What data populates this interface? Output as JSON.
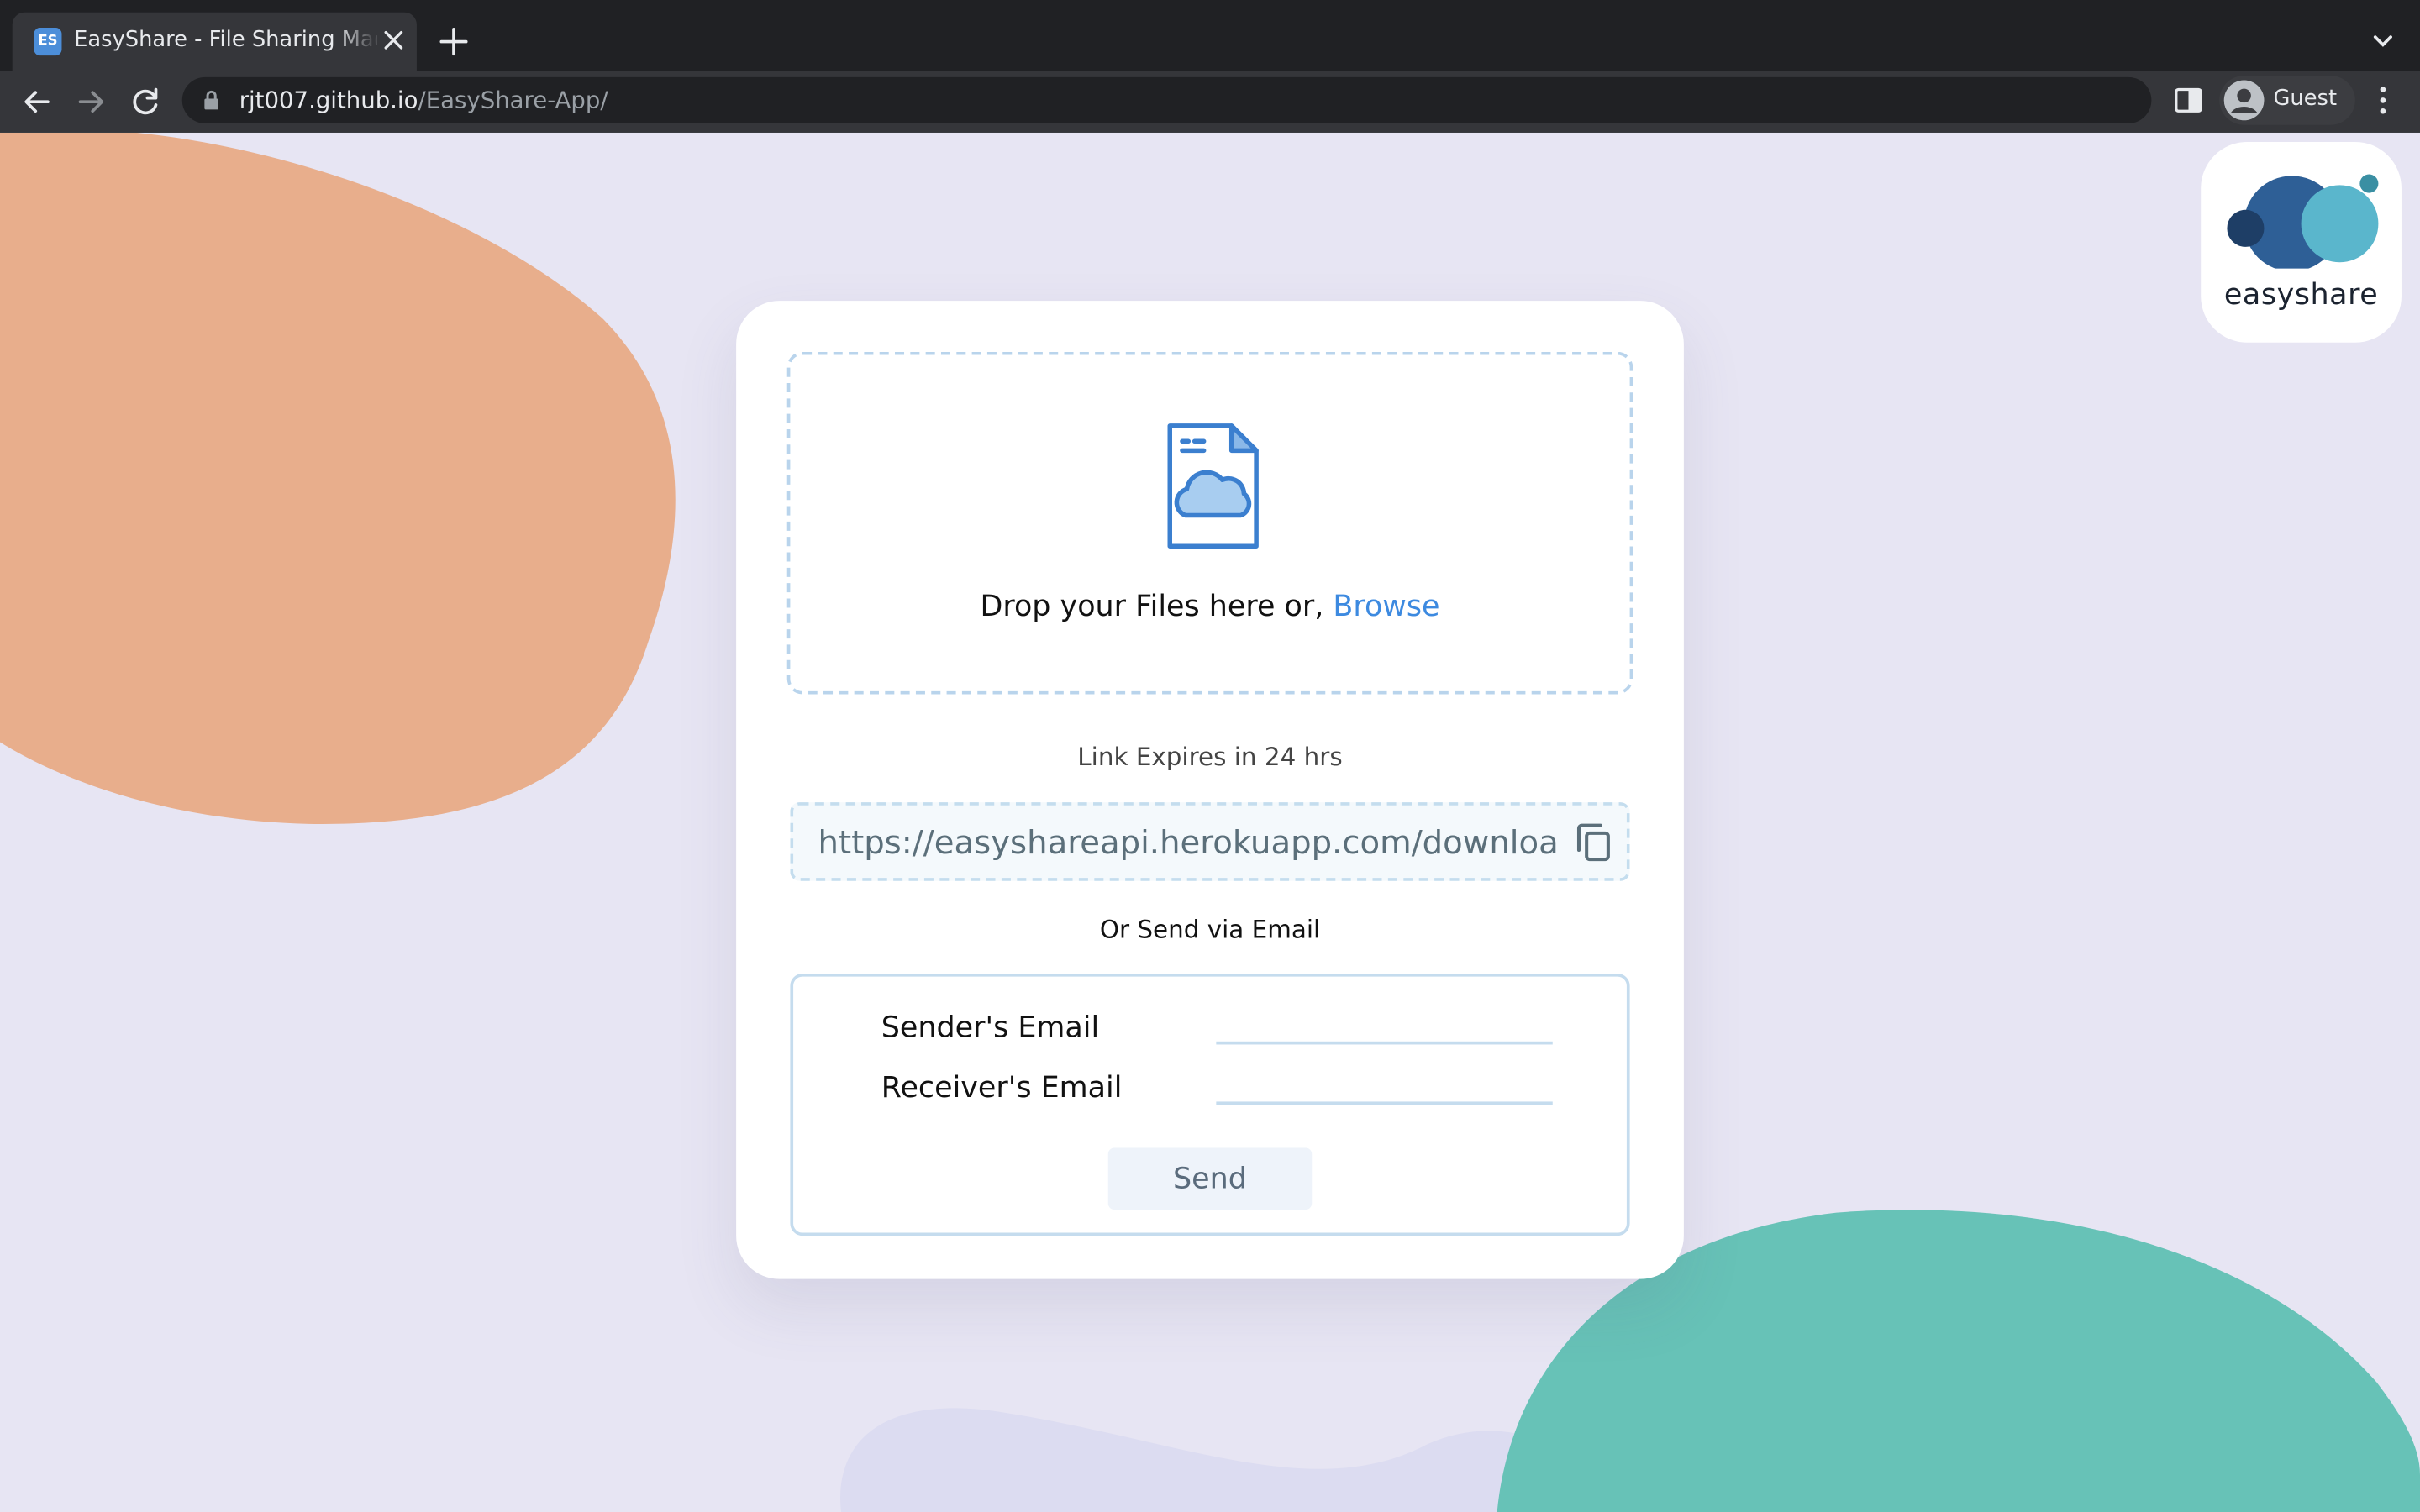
{
  "browser": {
    "tab_title": "EasyShare - File Sharing Made Easy",
    "favicon_text": "ES",
    "url_host": "rjt007.github.io",
    "url_path": "/EasyShare-App/",
    "profile_label": "Guest"
  },
  "logo": {
    "text": "easyshare"
  },
  "upload": {
    "drop_text": "Drop your Files here or, ",
    "browse_label": "Browse"
  },
  "share": {
    "expires_text": "Link Expires in 24 hrs",
    "link_value": "https://easyshareapi.herokuapp.com/downloads/"
  },
  "email": {
    "heading": "Or Send via Email",
    "sender_label": "Sender's Email",
    "receiver_label": "Receiver's Email",
    "sender_value": "",
    "receiver_value": "",
    "send_label": "Send"
  },
  "colors": {
    "page_bg": "#e7e5f3",
    "blob_orange": "#e8ae8c",
    "blob_teal": "#67c2b7",
    "accent_blue": "#3d8ae0"
  },
  "icons": [
    "file-cloud-icon",
    "copy-icon",
    "lock-icon",
    "back-arrow-icon",
    "forward-arrow-icon",
    "reload-icon",
    "close-icon",
    "plus-icon",
    "chevron-down-icon",
    "side-panel-icon",
    "user-avatar-icon",
    "kebab-menu-icon"
  ]
}
